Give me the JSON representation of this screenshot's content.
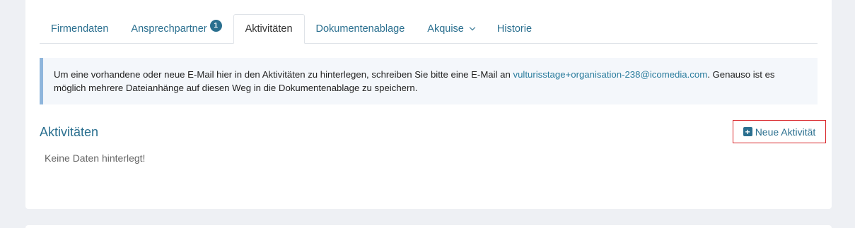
{
  "tabs": [
    {
      "label": "Firmendaten",
      "active": false
    },
    {
      "label": "Ansprechpartner",
      "active": false,
      "badge": "1"
    },
    {
      "label": "Aktivitäten",
      "active": true
    },
    {
      "label": "Dokumentenablage",
      "active": false
    },
    {
      "label": "Akquise",
      "active": false,
      "dropdown": true
    },
    {
      "label": "Historie",
      "active": false
    }
  ],
  "info": {
    "text_before": "Um eine vorhandene oder neue E-Mail hier in den Aktivitäten zu hinterlegen, schreiben Sie bitte eine E-Mail an ",
    "email": "vulturisstage+organisation-238@icomedia.com",
    "text_after": ". Genauso ist es möglich mehrere Dateianhänge auf diesen Weg in die Dokumentenablage zu speichern."
  },
  "section": {
    "title": "Aktivitäten",
    "new_button_label": "Neue Aktivität",
    "empty_text": "Keine Daten hinterlegt!"
  },
  "colors": {
    "accent": "#2a6f8f",
    "info_border": "#8fb6dc",
    "highlight_border": "#d9262b"
  },
  "icons": {
    "new_button": "plus-square-icon",
    "akquise_dropdown": "chevron-down-icon"
  }
}
